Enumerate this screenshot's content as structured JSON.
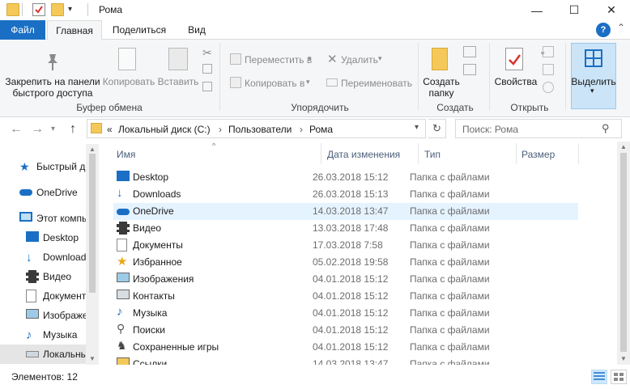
{
  "window": {
    "title": "Рома",
    "minimize": "—",
    "maximize": "☐",
    "close": "✕"
  },
  "ribbon_tabs": {
    "file": "Файл",
    "home": "Главная",
    "share": "Поделиться",
    "view": "Вид",
    "help": "?"
  },
  "ribbon": {
    "clipboard": {
      "group_label": "Буфер обмена",
      "pin_label": "Закрепить на панели быстрого доступа",
      "copy_label": "Копировать",
      "paste_label": "Вставить"
    },
    "organize": {
      "group_label": "Упорядочить",
      "move_label": "Переместить в",
      "copy_to_label": "Копировать в",
      "delete_label": "Удалить",
      "rename_label": "Переименовать"
    },
    "create": {
      "group_label": "Создать",
      "new_folder_label": "Создать папку"
    },
    "open": {
      "group_label": "Открыть",
      "properties_label": "Свойства"
    },
    "select": {
      "select_label": "Выделить"
    }
  },
  "address": {
    "overflow": "«",
    "crumbs": [
      "Локальный диск (C:)",
      "Пользователи",
      "Рома"
    ],
    "separator": "›",
    "search_placeholder": "Поиск: Рома"
  },
  "nav_pane": {
    "items": [
      {
        "label": "Быстрый доступ",
        "icon": "star-icon"
      },
      {
        "label": "OneDrive",
        "icon": "cloud-icon"
      },
      {
        "label": "Этот компьютер",
        "icon": "computer-icon"
      },
      {
        "label": "Desktop",
        "icon": "desktop-icon"
      },
      {
        "label": "Downloads",
        "icon": "download-icon"
      },
      {
        "label": "Видео",
        "icon": "video-icon"
      },
      {
        "label": "Документы",
        "icon": "documents-icon"
      },
      {
        "label": "Изображения",
        "icon": "images-icon"
      },
      {
        "label": "Музыка",
        "icon": "music-icon"
      },
      {
        "label": "Локальный диск (C:)",
        "icon": "drive-icon"
      }
    ]
  },
  "columns": {
    "name": "Имя",
    "date": "Дата изменения",
    "type": "Тип",
    "size": "Размер"
  },
  "files": [
    {
      "name": "Desktop",
      "date": "26.03.2018 15:12",
      "type": "Папка с файлами",
      "icon": "desktop-icon"
    },
    {
      "name": "Downloads",
      "date": "26.03.2018 15:13",
      "type": "Папка с файлами",
      "icon": "download-icon"
    },
    {
      "name": "OneDrive",
      "date": "14.03.2018 13:47",
      "type": "Папка с файлами",
      "icon": "cloud-icon"
    },
    {
      "name": "Видео",
      "date": "13.03.2018 17:48",
      "type": "Папка с файлами",
      "icon": "video-icon"
    },
    {
      "name": "Документы",
      "date": "17.03.2018 7:58",
      "type": "Папка с файлами",
      "icon": "documents-icon"
    },
    {
      "name": "Избранное",
      "date": "05.02.2018 19:58",
      "type": "Папка с файлами",
      "icon": "star-icon"
    },
    {
      "name": "Изображения",
      "date": "04.01.2018 15:12",
      "type": "Папка с файлами",
      "icon": "images-icon"
    },
    {
      "name": "Контакты",
      "date": "04.01.2018 15:12",
      "type": "Папка с файлами",
      "icon": "contacts-icon"
    },
    {
      "name": "Музыка",
      "date": "04.01.2018 15:12",
      "type": "Папка с файлами",
      "icon": "music-icon"
    },
    {
      "name": "Поиски",
      "date": "04.01.2018 15:12",
      "type": "Папка с файлами",
      "icon": "search-icon"
    },
    {
      "name": "Сохраненные игры",
      "date": "04.01.2018 15:12",
      "type": "Папка с файлами",
      "icon": "games-icon"
    },
    {
      "name": "Ссылки",
      "date": "14.03.2018 13:47",
      "type": "Папка с файлами",
      "icon": "links-icon"
    }
  ],
  "status": {
    "items_count": "Элементов: 12"
  },
  "colors": {
    "accent": "#1a6fc4",
    "selection": "#e5f3ff"
  }
}
